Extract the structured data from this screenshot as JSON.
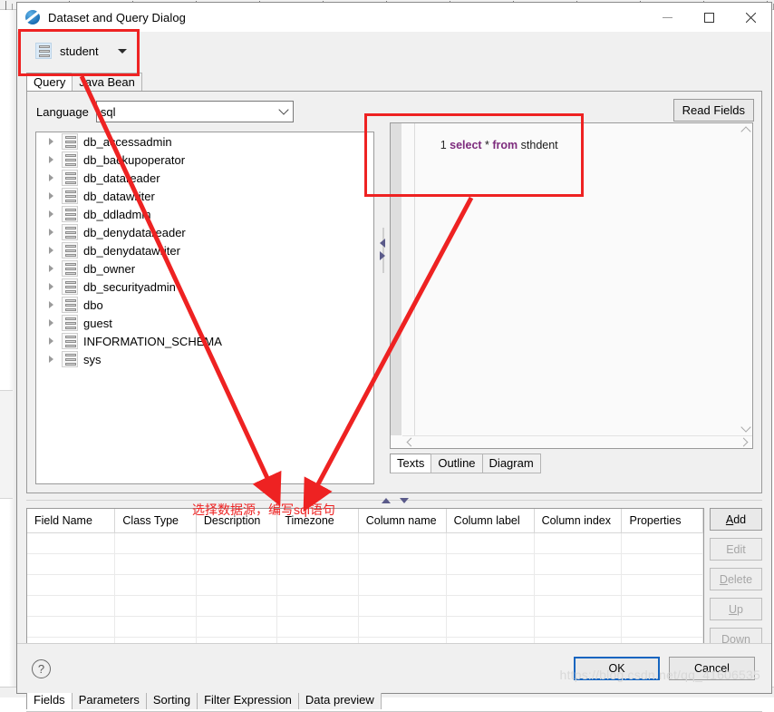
{
  "window": {
    "title": "Dataset and Query Dialog",
    "app_icon": "birt-dialog-icon",
    "minimize_label": "—",
    "maximize_label": "□",
    "close_label": "✕"
  },
  "dataset": {
    "icon": "database-table-icon",
    "name": "student",
    "dropdown_icon": "caret-down-icon"
  },
  "top_tabs": [
    {
      "label": "Query",
      "active": true
    },
    {
      "label": "Java Bean",
      "active": false
    }
  ],
  "language": {
    "label": "Language",
    "value": "sql",
    "placeholder": "",
    "caret_icon": "chevron-down-icon"
  },
  "read_fields_button": "Read Fields",
  "tree": {
    "expander_icon": "chevron-right-icon",
    "node_icon": "schema-icon",
    "items": [
      "db_accessadmin",
      "db_backupoperator",
      "db_datareader",
      "db_datawriter",
      "db_ddladmin",
      "db_denydatareader",
      "db_denydatawriter",
      "db_owner",
      "db_securityadmin",
      "dbo",
      "guest",
      "INFORMATION_SCHEMA",
      "sys"
    ]
  },
  "sash": {
    "collapse_left_icon": "triangle-left-icon",
    "collapse_right_icon": "triangle-right-icon",
    "collapse_up_icon": "triangle-up-icon",
    "collapse_down_icon": "triangle-down-icon"
  },
  "editor": {
    "line_number": "1",
    "tokens": [
      {
        "text": "select",
        "type": "keyword"
      },
      {
        "text": " * ",
        "type": "plain"
      },
      {
        "text": "from",
        "type": "keyword"
      },
      {
        "text": " sthdent",
        "type": "plain"
      }
    ],
    "full_text": "select * from sthdent",
    "vscroll_up_icon": "chevron-up-icon",
    "vscroll_down_icon": "chevron-down-icon",
    "hscroll_left_icon": "chevron-left-icon",
    "hscroll_right_icon": "chevron-right-icon"
  },
  "editor_tabs": [
    {
      "label": "Texts",
      "active": true
    },
    {
      "label": "Outline",
      "active": false
    },
    {
      "label": "Diagram",
      "active": false
    }
  ],
  "fields_table": {
    "columns": [
      "Field Name",
      "Class Type",
      "Description",
      "Timezone",
      "Column name",
      "Column label",
      "Column index",
      "Properties"
    ],
    "rows": [],
    "empty_row_count": 7
  },
  "side_buttons": [
    {
      "label": "Add",
      "mnemonic": "A",
      "rest": "dd",
      "enabled": true
    },
    {
      "label": "Edit",
      "mnemonic": "",
      "rest": "Edit",
      "enabled": false
    },
    {
      "label": "Delete",
      "mnemonic": "D",
      "rest": "elete",
      "enabled": false
    },
    {
      "label": "Up",
      "mnemonic": "U",
      "rest": "p",
      "enabled": false
    },
    {
      "label": "Down",
      "mnemonic": "D",
      "rest": "own",
      "enabled": false
    }
  ],
  "bottom_tabs": [
    {
      "label": "Fields",
      "active": true
    },
    {
      "label": "Parameters",
      "active": false
    },
    {
      "label": "Sorting",
      "active": false
    },
    {
      "label": "Filter Expression",
      "active": false
    },
    {
      "label": "Data preview",
      "active": false
    }
  ],
  "footer": {
    "help_icon": "question-mark-icon",
    "ok_label": "OK",
    "cancel_label": "Cancel"
  },
  "annotations": {
    "note_text": "选择数据源，编写sql语句",
    "highlight_color": "#ee2222",
    "arrow_count": 2,
    "box_count": 2
  },
  "watermark": "https://blog.csdn.net/qq_41606535",
  "colors": {
    "keyword": "#7d2b7d",
    "annotation_red": "#ee2222",
    "focus_blue": "#1565c0",
    "dialog_bg": "#f0f0f0"
  }
}
